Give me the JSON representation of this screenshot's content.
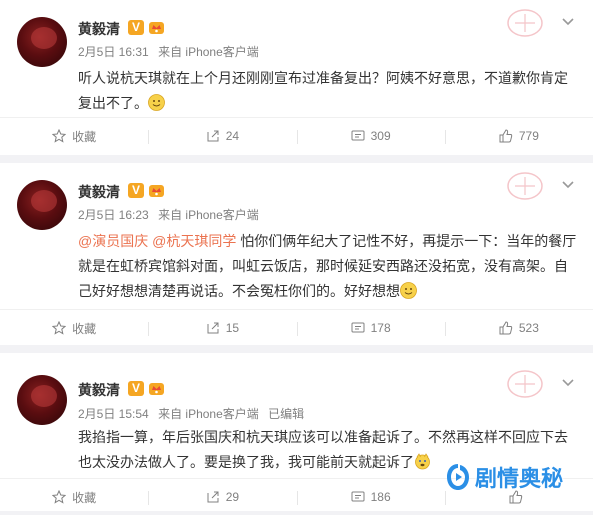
{
  "posts": [
    {
      "author": "黄毅清",
      "badge": "V",
      "time": "2月5日 16:31",
      "source": "来自 iPhone客户端",
      "edited": "",
      "text_parts": [
        "听人说杭天琪就在上个月还刚刚宣布过准备复出？阿姨不好意思，不道歉你肯定复出不了。"
      ],
      "emoji": "smile-emoji",
      "actions": {
        "favorite": "收藏",
        "repost": "24",
        "comment": "309",
        "like": "779"
      }
    },
    {
      "author": "黄毅清",
      "badge": "V",
      "time": "2月5日 16:23",
      "source": "来自 iPhone客户端",
      "edited": "",
      "mention1": "@演员国庆",
      "mention2": "@杭天琪同学",
      "text_parts": [
        "怕你们俩年纪大了记性不好，再提示一下：当年的餐厅就是在虹桥宾馆斜对面，叫虹云饭店，那时候延安西路还没拓宽，没有高架。自己好好想想清楚再说话。不会冤枉你们的。好好想想"
      ],
      "emoji": "smile-emoji",
      "actions": {
        "favorite": "收藏",
        "repost": "15",
        "comment": "178",
        "like": "523"
      }
    },
    {
      "author": "黄毅清",
      "badge": "V",
      "time": "2月5日 15:54",
      "source": "来自 iPhone客户端",
      "edited": "已编辑",
      "text_parts": [
        "我掐指一算，年后张国庆和杭天琪应该可以准备起诉了。不然再这样不回应下去也太没办法做人了。要是换了我，我可能前天就起诉了"
      ],
      "emoji": "doge-emoji",
      "actions": {
        "favorite": "收藏",
        "repost": "29",
        "comment": "186",
        "like": ""
      }
    }
  ],
  "watermark": "剧情奥秘",
  "colors": {
    "mention": "#eb7350",
    "badge": "#f5a623",
    "meta": "#808080",
    "watermark": "#2b8fe6"
  }
}
